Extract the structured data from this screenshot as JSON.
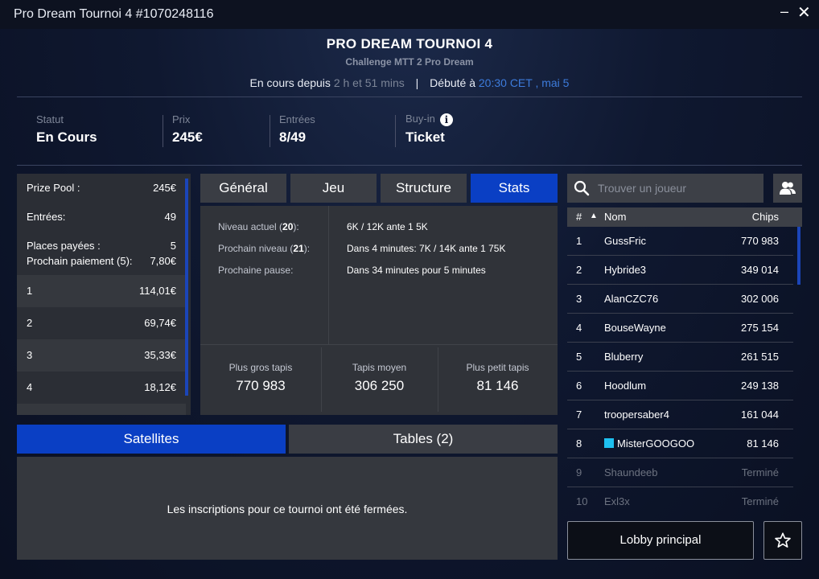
{
  "window": {
    "title": "Pro Dream Tournoi 4 #1070248116",
    "min": "–",
    "close": "✕"
  },
  "header": {
    "title": "PRO DREAM TOURNOI 4",
    "subtitle": "Challenge MTT 2 Pro Dream",
    "running_label": "En cours depuis",
    "running_value": "2 h et 51 mins",
    "separator": "|",
    "started_label": "Débuté à",
    "started_value": "20:30 CET , mai 5"
  },
  "summary": {
    "status_label": "Statut",
    "status_value": "En Cours",
    "prize_label": "Prix",
    "prize_value": "245€",
    "entries_label": "Entrées",
    "entries_value": "8/49",
    "buyin_label": "Buy-in",
    "buyin_value": "Ticket",
    "buyin_info_icon": "info-icon"
  },
  "prize": {
    "pool_label": "Prize Pool :",
    "pool_value": "245€",
    "entries_label": "Entrées:",
    "entries_value": "49",
    "places_label": "Places payées :",
    "places_value": "5",
    "next_label": "Prochain paiement (5):",
    "next_value": "7,80€",
    "rows": [
      {
        "rank": "1",
        "amount": "114,01€"
      },
      {
        "rank": "2",
        "amount": "69,74€"
      },
      {
        "rank": "3",
        "amount": "35,33€"
      },
      {
        "rank": "4",
        "amount": "18,12€"
      }
    ]
  },
  "tabs": {
    "general": "Général",
    "game": "Jeu",
    "structure": "Structure",
    "stats": "Stats",
    "active": "Stats"
  },
  "stats": {
    "current_level_label_pre": "Niveau actuel (",
    "current_level_num": "20",
    "current_level_label_post": "):",
    "current_level_value": "6K / 12K ante 1 5K",
    "next_level_label_pre": "Prochain niveau (",
    "next_level_num": "21",
    "next_level_label_post": "):",
    "next_level_value": "Dans 4 minutes: 7K / 14K ante 1 75K",
    "next_break_label": "Prochaine pause:",
    "next_break_value": "Dans 34 minutes pour 5 minutes",
    "biggest_label": "Plus gros tapis",
    "biggest_value": "770 983",
    "average_label": "Tapis moyen",
    "average_value": "306 250",
    "smallest_label": "Plus petit tapis",
    "smallest_value": "81 146"
  },
  "bottom_tabs": {
    "satellites": "Satellites",
    "tables": "Tables (2)"
  },
  "closed_message": "Les inscriptions pour ce tournoi ont été fermées.",
  "search": {
    "placeholder": "Trouver un joueur",
    "icon": "search-icon"
  },
  "players": {
    "col_rank": "#",
    "col_sort": "▲",
    "col_name": "Nom",
    "col_chips": "Chips",
    "rows": [
      {
        "rank": "1",
        "name": "GussFric",
        "chips": "770 983"
      },
      {
        "rank": "2",
        "name": "Hybride3",
        "chips": "349 014"
      },
      {
        "rank": "3",
        "name": "AlanCZC76",
        "chips": "302 006"
      },
      {
        "rank": "4",
        "name": "BouseWayne",
        "chips": "275 154"
      },
      {
        "rank": "5",
        "name": "Bluberry",
        "chips": "261 515"
      },
      {
        "rank": "6",
        "name": "Hoodlum",
        "chips": "249 138"
      },
      {
        "rank": "7",
        "name": "troopersaber4",
        "chips": "161 044"
      },
      {
        "rank": "8",
        "name": "MisterGOOGOO",
        "chips": "81 146"
      },
      {
        "rank": "9",
        "name": "Shaundeeb",
        "chips": "Terminé"
      },
      {
        "rank": "10",
        "name": "Exl3x",
        "chips": "Terminé"
      }
    ]
  },
  "buttons": {
    "lobby": "Lobby principal",
    "favorite_icon": "star-icon"
  },
  "colors": {
    "accent": "#0a3fc4",
    "link": "#3d7bdb",
    "panel": "#2b2e35"
  }
}
